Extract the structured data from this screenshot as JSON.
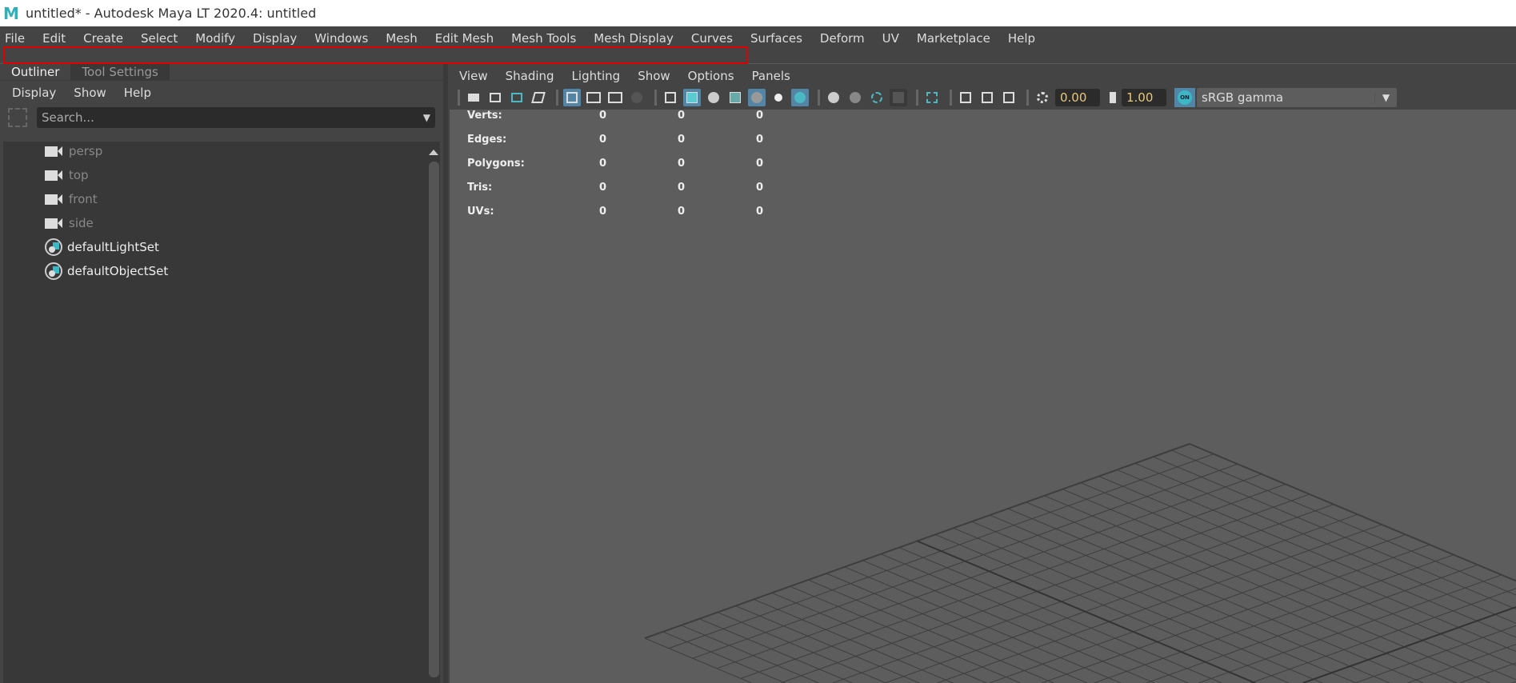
{
  "window": {
    "title": "untitled* - Autodesk Maya LT 2020.4: untitled",
    "logo": "M"
  },
  "menubar": [
    "File",
    "Edit",
    "Create",
    "Select",
    "Modify",
    "Display",
    "Windows",
    "Mesh",
    "Edit Mesh",
    "Mesh Tools",
    "Mesh Display",
    "Curves",
    "Surfaces",
    "Deform",
    "UV",
    "Marketplace",
    "Help"
  ],
  "outliner": {
    "tabs": [
      "Outliner",
      "Tool Settings"
    ],
    "menu": [
      "Display",
      "Show",
      "Help"
    ],
    "search_placeholder": "Search...",
    "items": [
      {
        "label": "persp",
        "icon": "camera-icon"
      },
      {
        "label": "top",
        "icon": "camera-icon"
      },
      {
        "label": "front",
        "icon": "camera-icon"
      },
      {
        "label": "side",
        "icon": "camera-icon"
      },
      {
        "label": "defaultLightSet",
        "icon": "set-icon"
      },
      {
        "label": "defaultObjectSet",
        "icon": "set-icon"
      }
    ]
  },
  "viewport": {
    "menu": [
      "View",
      "Shading",
      "Lighting",
      "Show",
      "Options",
      "Panels"
    ],
    "exposure": "0.00",
    "gamma": "1.00",
    "color_management_on": "ON",
    "color_space": "sRGB gamma",
    "hud": [
      {
        "label": "Verts:",
        "values": [
          "0",
          "0",
          "0"
        ]
      },
      {
        "label": "Edges:",
        "values": [
          "0",
          "0",
          "0"
        ]
      },
      {
        "label": "Polygons:",
        "values": [
          "0",
          "0",
          "0"
        ]
      },
      {
        "label": "Tris:",
        "values": [
          "0",
          "0",
          "0"
        ]
      },
      {
        "label": "UVs:",
        "values": [
          "0",
          "0",
          "0"
        ]
      }
    ]
  }
}
